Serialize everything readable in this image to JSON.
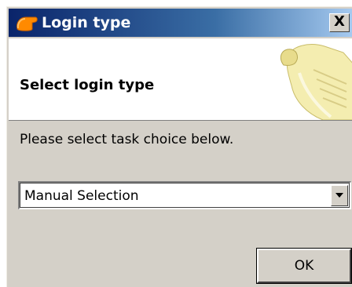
{
  "window": {
    "title": "Login type",
    "close_label": "X",
    "icon": "orange-app-icon",
    "titlebar_colors": [
      "#0a246a",
      "#a6caf0"
    ]
  },
  "header": {
    "title": "Select login type",
    "art_icon": "scroll-document-icon"
  },
  "body": {
    "instruction": "Please select task choice below."
  },
  "login_select": {
    "value": "Manual Selection",
    "arrow_icon": "dropdown-arrow-icon"
  },
  "buttons": {
    "ok_label": "OK"
  }
}
